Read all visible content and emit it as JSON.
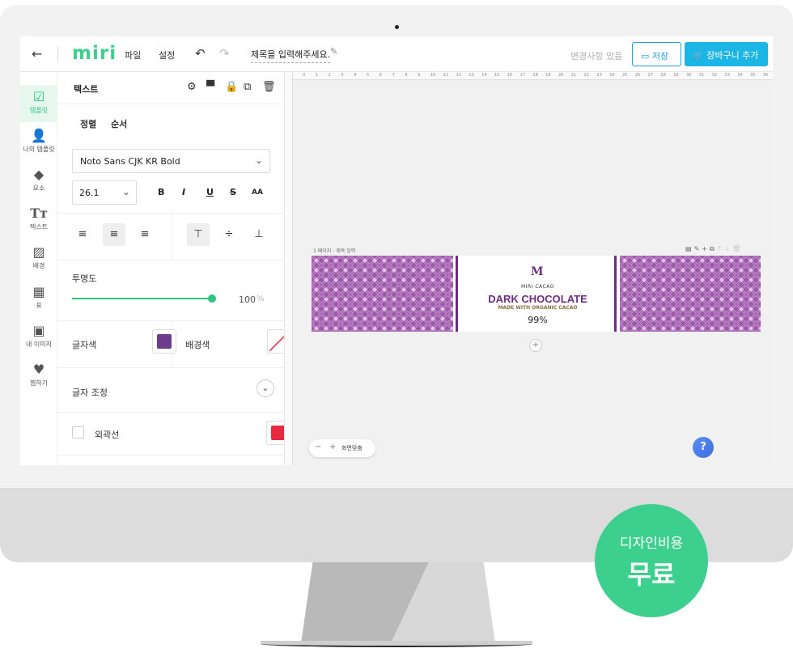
{
  "topbar": {
    "logo": "miri",
    "menu": [
      "파일",
      "설정"
    ],
    "document_title": "제목을 입력해주세요.",
    "change_status": "변경사항 있음",
    "save_label": "저장",
    "cart_label": "장바구니 추가"
  },
  "sidebar": {
    "items": [
      {
        "label": "템플릿",
        "icon": "template-icon",
        "active": true
      },
      {
        "label": "나의 템플릿",
        "icon": "my-template-icon",
        "active": false
      },
      {
        "label": "요소",
        "icon": "elements-icon",
        "active": false
      },
      {
        "label": "텍스트",
        "icon": "text-icon",
        "active": false
      },
      {
        "label": "배경",
        "icon": "background-icon",
        "active": false
      },
      {
        "label": "표",
        "icon": "table-icon",
        "active": false
      },
      {
        "label": "내 이미지",
        "icon": "my-image-icon",
        "active": false
      },
      {
        "label": "찜하기",
        "icon": "heart-icon",
        "active": false
      }
    ]
  },
  "panel": {
    "title": "텍스트",
    "tabs": [
      "정렬",
      "순서"
    ],
    "font_family": "Noto Sans CJK KR Bold",
    "font_size": "26.1",
    "format_buttons": [
      "B",
      "I",
      "U",
      "S",
      "AA"
    ],
    "opacity_label": "투명도",
    "opacity_value": "100",
    "opacity_unit": "%",
    "opacity_fraction": 1.0,
    "text_color_label": "글자색",
    "text_color": "#6e3d8e",
    "bg_color_label": "배경색",
    "adjust_label": "글자 조정",
    "outline_label": "외곽선",
    "outline_color": "#e8283f"
  },
  "canvas": {
    "page_label": "1 페이지 - 제목 입력",
    "fit_label": "화면맞춤",
    "design": {
      "brand": "MIRI CACAO",
      "product": "DARK CHOCOLATE",
      "subtitle": "MADE WITH ORGANIC CACAO",
      "percent": "99%"
    }
  },
  "promo": {
    "line1": "디자인비용",
    "line2": "무료"
  },
  "colors": {
    "accent": "#3ccf8e",
    "primary_button": "#1cb6e6",
    "pattern": "#9b5ba7"
  }
}
